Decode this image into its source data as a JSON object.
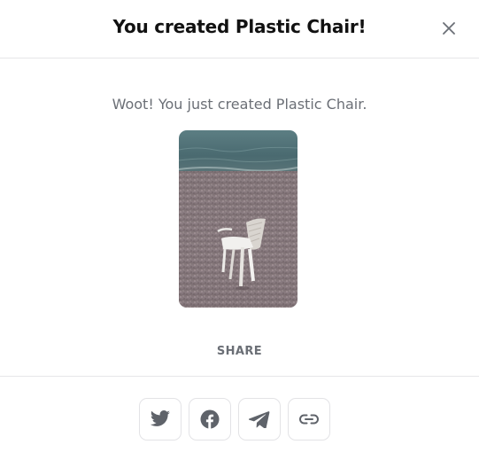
{
  "dialog": {
    "title": "You created Plastic Chair!",
    "message": "Woot! You just created Plastic Chair.",
    "close_icon": "close-icon"
  },
  "preview": {
    "subject": "white plastic chair on pebble beach",
    "colors": {
      "sea": "#4f6f74",
      "pebbles": "#8c7f83",
      "chair": "#ecebe8"
    }
  },
  "share": {
    "label": "SHARE",
    "buttons": [
      {
        "icon": "twitter-icon"
      },
      {
        "icon": "facebook-icon"
      },
      {
        "icon": "telegram-icon"
      },
      {
        "icon": "link-icon"
      }
    ]
  },
  "colors": {
    "title_text": "#111111",
    "muted_text": "#6b6f76",
    "icon": "#5f636a",
    "border": "#e3e3e6"
  }
}
